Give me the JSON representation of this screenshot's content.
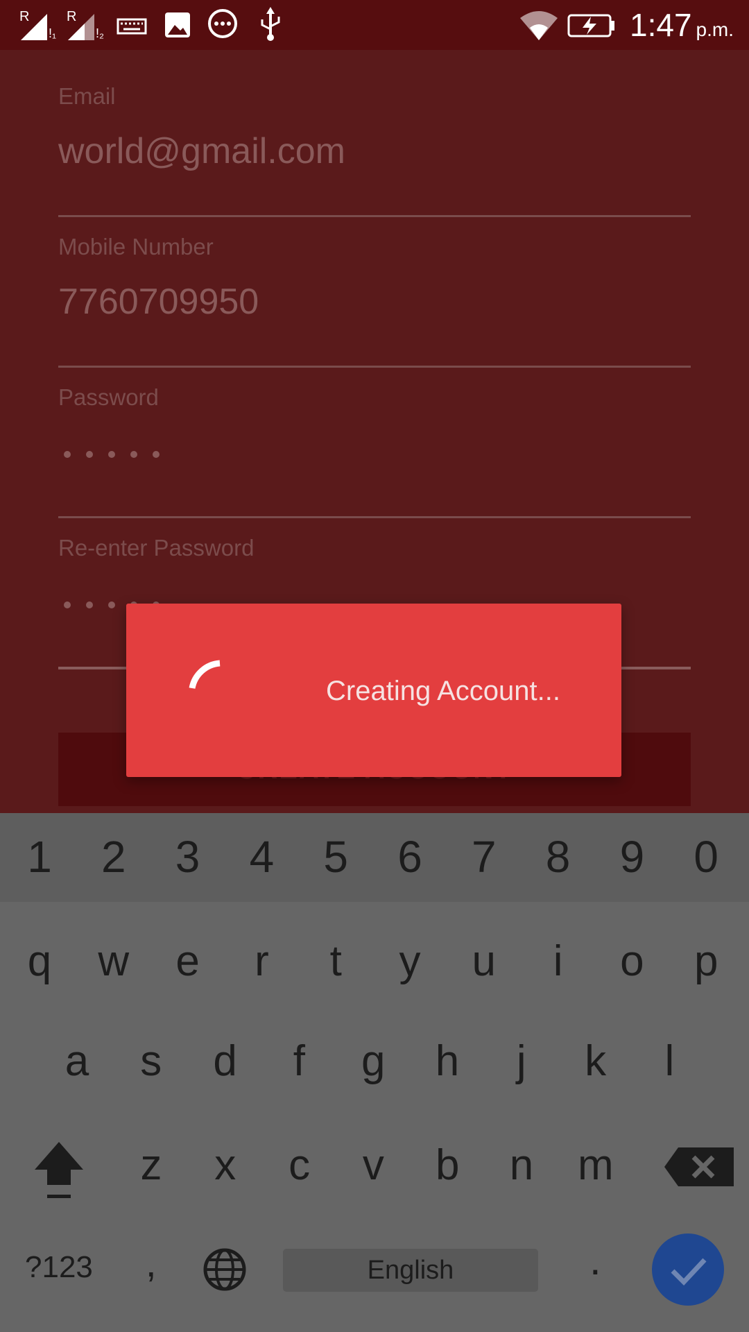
{
  "status_bar": {
    "time": "1:47",
    "ampm": "p.m.",
    "icons": [
      "signal-sim1-icon",
      "signal-sim2-icon",
      "keyboard-icon",
      "image-icon",
      "message-icon",
      "usb-icon",
      "wifi-icon",
      "battery-charging-icon"
    ]
  },
  "form": {
    "email": {
      "label": "Email",
      "value": "world@gmail.com"
    },
    "mobile": {
      "label": "Mobile Number",
      "value": "7760709950"
    },
    "password": {
      "label": "Password",
      "masked_length": 5
    },
    "reenter_password": {
      "label": "Re-enter Password",
      "masked_length": 5
    },
    "create_button": "CREATE ACCOUNT"
  },
  "dialog": {
    "message": "Creating Account..."
  },
  "keyboard": {
    "numbers": [
      "1",
      "2",
      "3",
      "4",
      "5",
      "6",
      "7",
      "8",
      "9",
      "0"
    ],
    "row1": [
      "q",
      "w",
      "e",
      "r",
      "t",
      "y",
      "u",
      "i",
      "o",
      "p"
    ],
    "row2": [
      "a",
      "s",
      "d",
      "f",
      "g",
      "h",
      "j",
      "k",
      "l"
    ],
    "row3": [
      "z",
      "x",
      "c",
      "v",
      "b",
      "n",
      "m"
    ],
    "symbols_label": "?123",
    "comma_label": ",",
    "space_label": "English",
    "period_label": "."
  },
  "colors": {
    "status_bar": "#560d0f",
    "background_dim": "#5a1a1b",
    "dialog": "#e33e3f",
    "enter_key": "#1f4791",
    "keyboard": "#666666"
  }
}
